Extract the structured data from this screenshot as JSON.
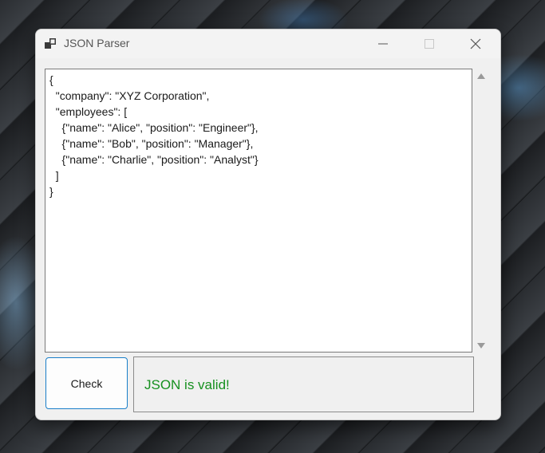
{
  "window": {
    "title": "JSON Parser",
    "app_icon": "app-window-icon",
    "controls": {
      "minimize_icon": "minimize-icon",
      "maximize_icon": "maximize-icon",
      "close_icon": "close-icon"
    }
  },
  "editor": {
    "content": "{\n  \"company\": \"XYZ Corporation\",\n  \"employees\": [\n    {\"name\": \"Alice\", \"position\": \"Engineer\"},\n    {\"name\": \"Bob\", \"position\": \"Manager\"},\n    {\"name\": \"Charlie\", \"position\": \"Analyst\"}\n  ]\n}"
  },
  "scrollbar": {
    "up_icon": "scroll-up-arrow-icon",
    "down_icon": "scroll-down-arrow-icon"
  },
  "actions": {
    "check_label": "Check"
  },
  "status": {
    "message": "JSON is valid!",
    "color": "#16901f"
  }
}
